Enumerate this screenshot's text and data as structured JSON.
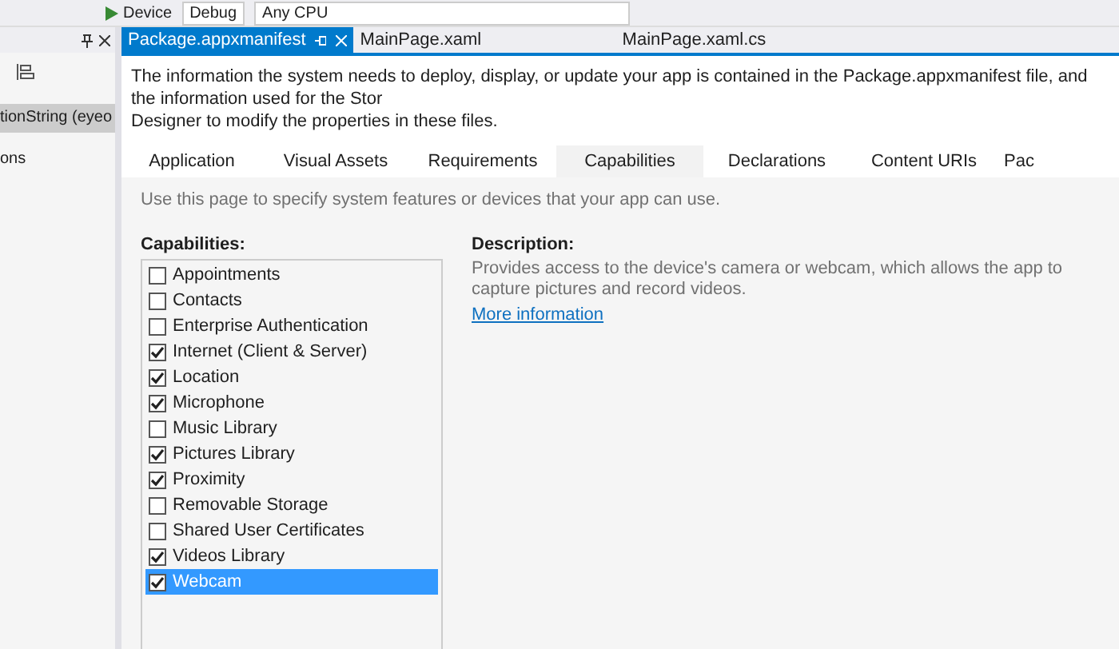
{
  "toolbar": {
    "run_target": "Device",
    "configuration": "Debug",
    "platform": "Any CPU"
  },
  "left_panel": {
    "items": [
      {
        "label": "tionString (eyeo",
        "selected": true
      },
      {
        "label": "ons",
        "selected": false
      }
    ]
  },
  "document_tabs": [
    {
      "label": "Package.appxmanifest",
      "selected": true
    },
    {
      "label": "MainPage.xaml",
      "selected": false
    },
    {
      "label": "MainPage.xaml.cs",
      "selected": false
    }
  ],
  "intro": "The information the system needs to deploy, display, or update your app is contained in the Package.appxmanifest file, and the information used for the Stor",
  "intro_line2": "Designer to modify the properties in these files.",
  "manifest_tabs": [
    {
      "label": "Application",
      "selected": false
    },
    {
      "label": "Visual Assets",
      "selected": false
    },
    {
      "label": "Requirements",
      "selected": false
    },
    {
      "label": "Capabilities",
      "selected": true
    },
    {
      "label": "Declarations",
      "selected": false
    },
    {
      "label": "Content URIs",
      "selected": false
    },
    {
      "label": "Pac",
      "selected": false
    }
  ],
  "hint": "Use this page to specify system features or devices that your app can use.",
  "capabilities": {
    "title": "Capabilities:",
    "items": [
      {
        "label": "Appointments",
        "checked": false,
        "selected": false
      },
      {
        "label": "Contacts",
        "checked": false,
        "selected": false
      },
      {
        "label": "Enterprise Authentication",
        "checked": false,
        "selected": false
      },
      {
        "label": "Internet (Client & Server)",
        "checked": true,
        "selected": false
      },
      {
        "label": "Location",
        "checked": true,
        "selected": false
      },
      {
        "label": "Microphone",
        "checked": true,
        "selected": false
      },
      {
        "label": "Music Library",
        "checked": false,
        "selected": false
      },
      {
        "label": "Pictures Library",
        "checked": true,
        "selected": false
      },
      {
        "label": "Proximity",
        "checked": true,
        "selected": false
      },
      {
        "label": "Removable Storage",
        "checked": false,
        "selected": false
      },
      {
        "label": "Shared User Certificates",
        "checked": false,
        "selected": false
      },
      {
        "label": "Videos Library",
        "checked": true,
        "selected": false
      },
      {
        "label": "Webcam",
        "checked": true,
        "selected": true
      }
    ]
  },
  "description": {
    "title": "Description:",
    "text": "Provides access to the device's camera or webcam, which allows the app to capture pictures and record videos.",
    "link": "More information"
  }
}
